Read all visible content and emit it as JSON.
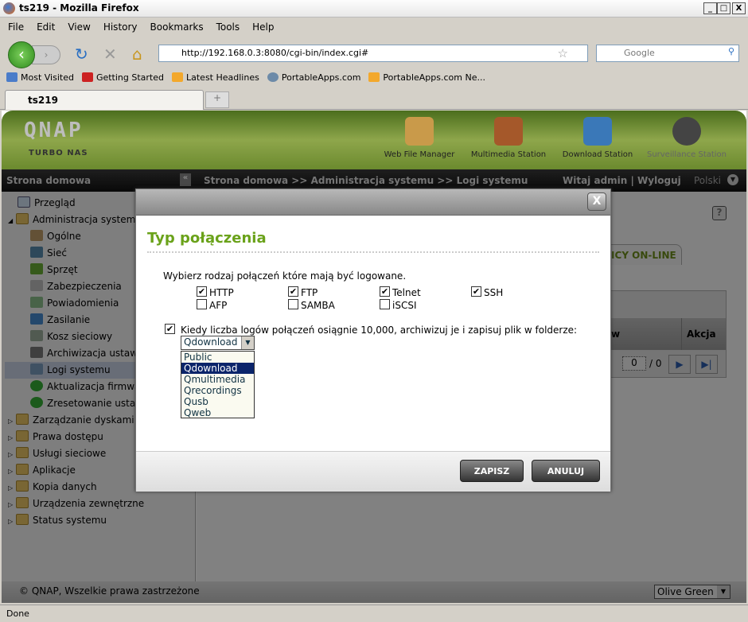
{
  "window": {
    "title": "ts219 - Mozilla Firefox",
    "controls": [
      "_",
      "□",
      "X"
    ]
  },
  "menu": [
    "File",
    "Edit",
    "View",
    "History",
    "Bookmarks",
    "Tools",
    "Help"
  ],
  "nav": {
    "url": "http://192.168.0.3:8080/cgi-bin/index.cgi#",
    "search_placeholder": "Google"
  },
  "bookmarks": [
    "Most Visited",
    "Getting Started",
    "Latest Headlines",
    "PortableApps.com",
    "PortableApps.com Ne..."
  ],
  "tab": {
    "label": "ts219"
  },
  "qnap": {
    "logo": "QNAP",
    "subtitle": "TURBO NAS",
    "apps": [
      {
        "label": "Web File Manager",
        "color": "#c99a4a"
      },
      {
        "label": "Multimedia Station",
        "color": "#a5582a"
      },
      {
        "label": "Download Station",
        "color": "#3a78b8"
      },
      {
        "label": "Surveillance Station",
        "color": "#444444"
      }
    ],
    "home": "Strona domowa",
    "breadcrumb": "Strona domowa >> Administracja systemu >> Logi systemu",
    "welcome": "Witaj admin | Wyloguj",
    "language": "Polski"
  },
  "sidebar": {
    "top": "Przegląd",
    "admin": "Administracja systemu",
    "admin_items": [
      "Ogólne",
      "Sieć",
      "Sprzęt",
      "Zabezpieczenia",
      "Powiadomienia",
      "Zasilanie",
      "Kosz sieciowy",
      "Archiwizacja ustawień",
      "Logi systemu",
      "Aktualizacja firmwaru",
      "Zresetowanie ustawień"
    ],
    "selected": "Logi systemu",
    "groups": [
      "Zarządzanie dyskami",
      "Prawa dostępu",
      "Usługi sieciowe",
      "Aplikacje",
      "Kopia danych",
      "Urządzenia zewnętrzne",
      "Status systemu"
    ]
  },
  "content": {
    "tab_label": "NICY ON-LINE",
    "col_action": "Akcja",
    "col_partial": "w",
    "page_value": "0",
    "page_total": "/ 0",
    "help": "?"
  },
  "footer": {
    "copyright": "© QNAP, Wszelkie prawa zastrzeżone",
    "theme": "Olive Green"
  },
  "dialog": {
    "close": "X",
    "title": "Typ połączenia",
    "instruction": "Wybierz rodzaj połączeń które mają być logowane.",
    "options": [
      {
        "label": "HTTP",
        "checked": true
      },
      {
        "label": "FTP",
        "checked": true
      },
      {
        "label": "Telnet",
        "checked": true
      },
      {
        "label": "SSH",
        "checked": true
      },
      {
        "label": "AFP",
        "checked": false
      },
      {
        "label": "SAMBA",
        "checked": false
      },
      {
        "label": "iSCSI",
        "checked": false
      }
    ],
    "archive": {
      "checked": true,
      "label": "Kiedy liczba logów połączeń osiągnie 10,000, archiwizuj je i zapisuj plik w folderze:"
    },
    "folder": {
      "selected": "Qdownload",
      "options": [
        "Public",
        "Qdownload",
        "Qmultimedia",
        "Qrecordings",
        "Qusb",
        "Qweb"
      ]
    },
    "save": "ZAPISZ",
    "cancel": "ANULUJ"
  },
  "status": "Done",
  "colors": {
    "accent": "#6aa21a",
    "highlight": "#0a246a"
  }
}
